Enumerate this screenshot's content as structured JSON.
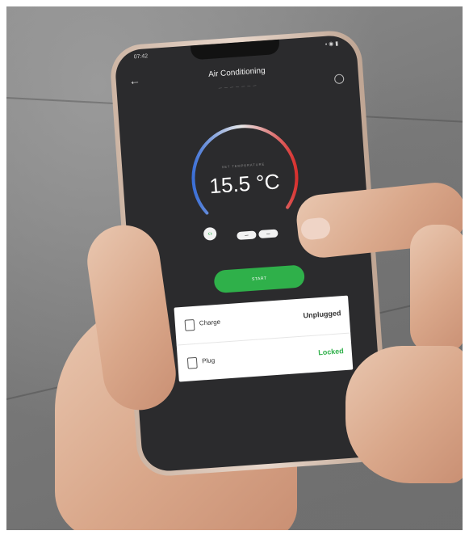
{
  "app": {
    "title": "Air Conditioning",
    "status_time": "07:42"
  },
  "climate": {
    "dial_label": "SET TEMPERATURE",
    "temperature": "15.5 °C",
    "start_label": "START",
    "minus_label": "–",
    "plus_label": "–"
  },
  "status": {
    "rows": [
      {
        "label": "Charge",
        "value": "Unplugged"
      },
      {
        "label": "Plug",
        "value": "Locked"
      }
    ]
  },
  "colors": {
    "accent_green": "#2fb04a",
    "screen_bg": "#2b2b2d",
    "dial_cold": "#3b6fd6",
    "dial_hot": "#d8312f"
  },
  "icons": {
    "back": "back-arrow-icon",
    "history": "clock-icon",
    "link": "link-icon",
    "charge": "charge-icon",
    "plug": "lock-icon"
  }
}
